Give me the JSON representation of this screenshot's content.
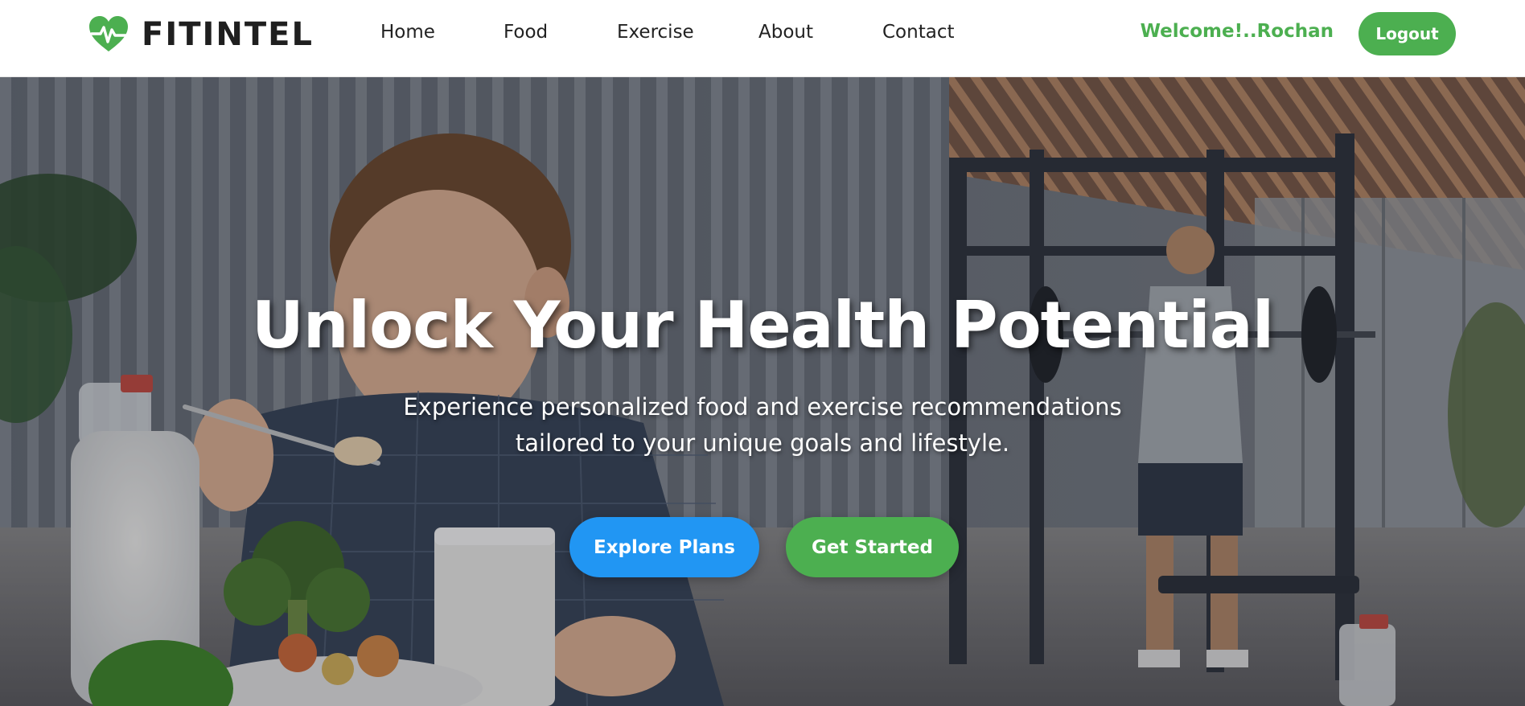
{
  "brand": {
    "name": "FITINTEL",
    "icon": "heart-pulse-icon",
    "icon_color": "#4caf50"
  },
  "nav": {
    "items": [
      {
        "label": "Home"
      },
      {
        "label": "Food"
      },
      {
        "label": "Exercise"
      },
      {
        "label": "About"
      },
      {
        "label": "Contact"
      }
    ]
  },
  "user": {
    "welcome_text": "Welcome!..Rochan",
    "logout_label": "Logout"
  },
  "hero": {
    "title": "Unlock Your Health Potential",
    "subtitle_line1": "Experience personalized food and exercise recommendations",
    "subtitle_line2": "tailored to your unique goals and lifestyle.",
    "explore_label": "Explore Plans",
    "start_label": "Get Started"
  },
  "colors": {
    "accent_green": "#4caf50",
    "accent_blue": "#2196f3",
    "text_dark": "#222222"
  }
}
